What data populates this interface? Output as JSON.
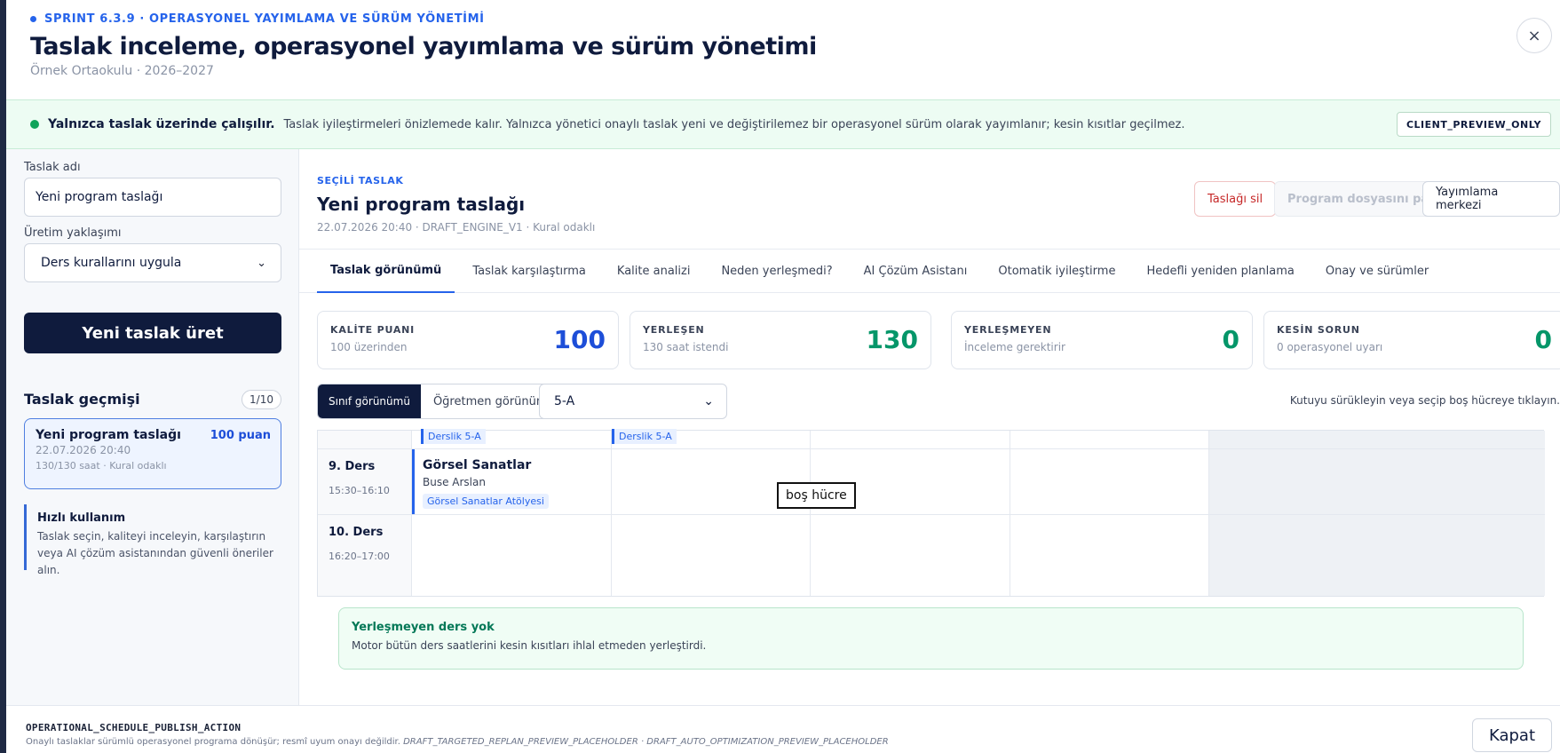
{
  "header": {
    "eyebrow": "SPRINT 6.3.9 · OPERASYONEL YAYIMLAMA VE SÜRÜM YÖNETİMİ",
    "title": "Taslak inceleme, operasyonel yayımlama ve sürüm yönetimi",
    "subtitle": "Örnek Ortaokulu · 2026–2027",
    "close_icon": "×"
  },
  "banner": {
    "title": "Yalnızca taslak üzerinde çalışılır.",
    "description": "Taslak iyileştirmeleri önizlemede kalır. Yalnızca yönetici onaylı taslak yeni ve değiştirilemez bir operasyonel sürüm olarak yayımlanır; kesin kısıtlar geçilmez.",
    "tag": "CLIENT_PREVIEW_ONLY"
  },
  "sidebar": {
    "name_label": "Taslak adı",
    "name_value": "Yeni program taslağı",
    "approach_label": "Üretim yaklaşımı",
    "approach_value": "Ders kurallarını uygula",
    "generate_button": "Yeni taslak üret",
    "history_title": "Taslak geçmişi",
    "history_count": "1/10",
    "history_item": {
      "name": "Yeni program taslağı",
      "score": "100 puan",
      "date": "22.07.2026 20:40",
      "meta": "130/130 saat · Kural odaklı"
    },
    "quick": {
      "title": "Hızlı kullanım",
      "description": "Taslak seçin, kaliteyi inceleyin, karşılaştırın veya AI çözüm asistanından güvenli öneriler alın."
    }
  },
  "main": {
    "eyebrow": "SEÇİLİ TASLAK",
    "draft_name": "Yeni program taslağı",
    "draft_meta": "22.07.2026 20:40 · DRAFT_ENGINE_V1 · Kural odaklı",
    "actions": {
      "delete": "Taslağı sil",
      "share": "Program dosyasını paylaş",
      "publish": "Yayımlama merkezi"
    },
    "tabs": [
      {
        "label": "Taslak görünümü"
      },
      {
        "label": "Taslak karşılaştırma"
      },
      {
        "label": "Kalite analizi"
      },
      {
        "label": "Neden yerleşmedi?"
      },
      {
        "label": "AI Çözüm Asistanı"
      },
      {
        "label": "Otomatik iyileştirme"
      },
      {
        "label": "Hedefli yeniden planlama"
      },
      {
        "label": "Onay ve sürümler"
      }
    ],
    "kpis": [
      {
        "label": "KALİTE PUANI",
        "sub": "100 üzerinden",
        "value": "100",
        "color": "#1d4ed8"
      },
      {
        "label": "YERLEŞEN",
        "sub": "130 saat istendi",
        "value": "130",
        "color": "#059669"
      },
      {
        "label": "YERLEŞMEYEN",
        "sub": "İnceleme gerektirir",
        "value": "0",
        "color": "#059669"
      },
      {
        "label": "KESİN SORUN",
        "sub": "0 operasyonel uyarı",
        "value": "0",
        "color": "#059669"
      }
    ],
    "view_class": "Sınıf görünümü",
    "view_teacher": "Öğretmen görünümü",
    "class_value": "5-A",
    "hint": "Kutuyu sürükleyin veya seçip boş hücreye tıklayın.",
    "grid": {
      "top_rooms": [
        "Derslik 5-A",
        "Derslik 5-A"
      ],
      "rows": [
        {
          "name": "9. Ders",
          "time": "15:30–16:10"
        },
        {
          "name": "10. Ders",
          "time": "16:20–17:00"
        }
      ],
      "lesson": {
        "name": "Görsel Sanatlar",
        "teacher": "Buse Arslan",
        "room": "Görsel Sanatlar Atölyesi"
      },
      "tooltip": "boş hücre"
    },
    "notice": {
      "title": "Yerleşmeyen ders yok",
      "description": "Motor bütün ders saatlerini kesin kısıtları ihlal etmeden yerleştirdi."
    }
  },
  "footer": {
    "title": "OPERATIONAL_SCHEDULE_PUBLISH_ACTION",
    "description": "Onaylı taslaklar sürümlü operasyonel programa dönüşür; resmî uyum onayı değildir.",
    "placeholders": "DRAFT_TARGETED_REPLAN_PREVIEW_PLACEHOLDER · DRAFT_AUTO_OPTIMIZATION_PREVIEW_PLACEHOLDER",
    "close_button": "Kapat"
  }
}
